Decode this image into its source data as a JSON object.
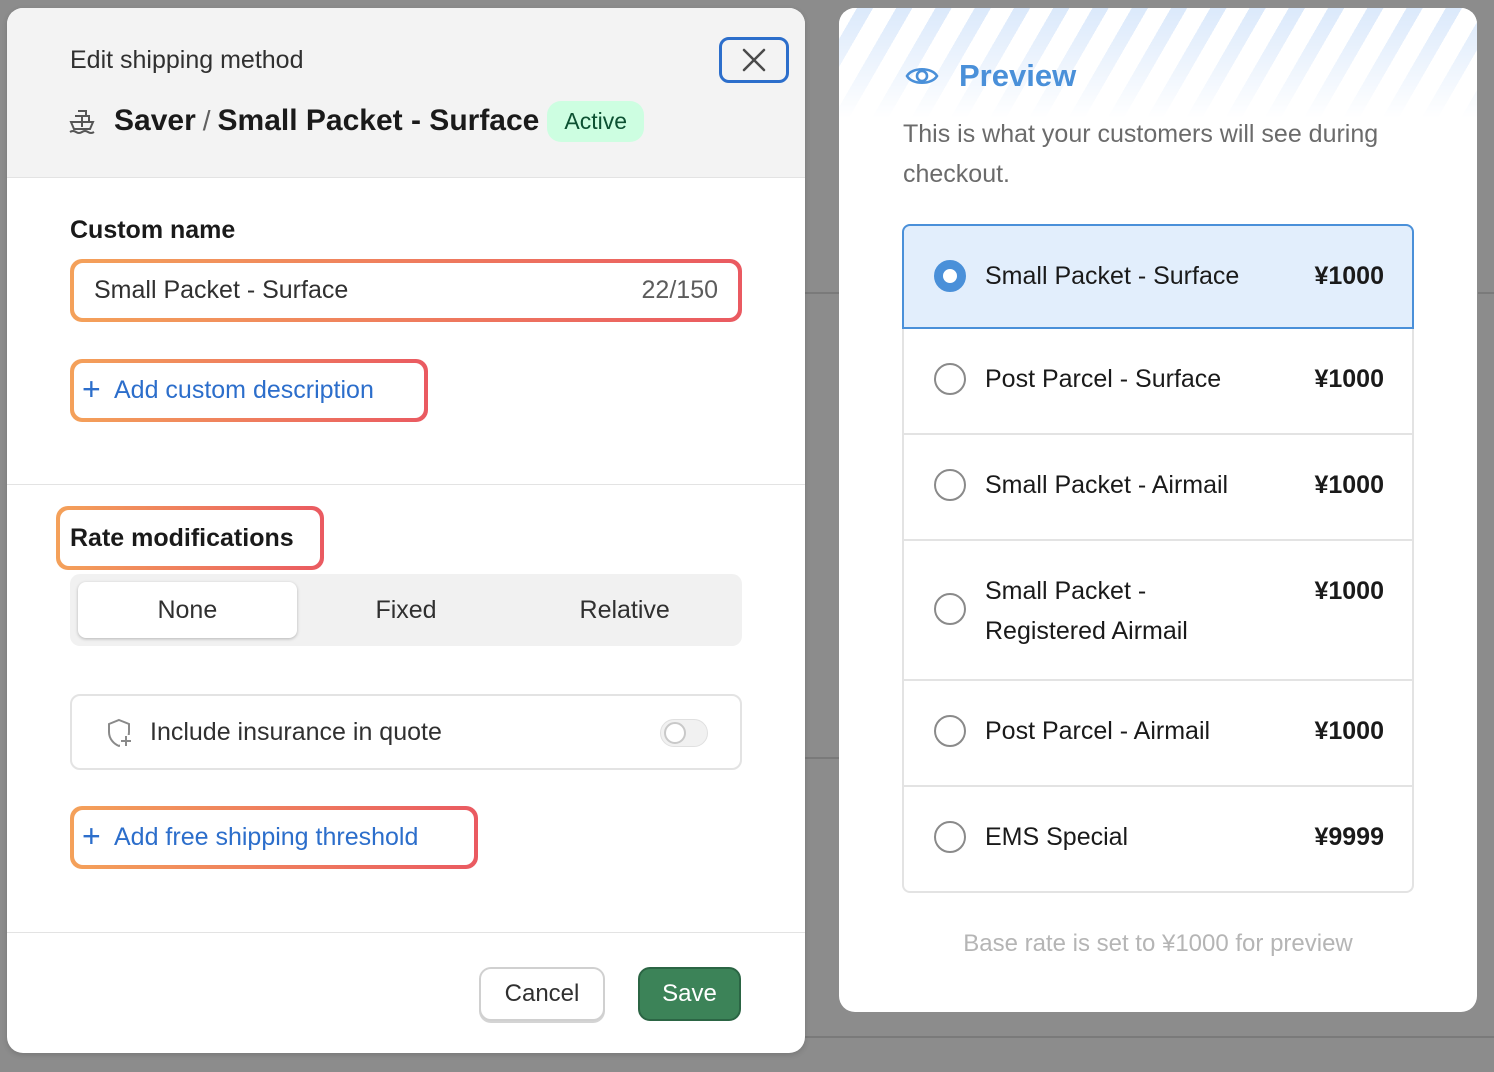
{
  "modal": {
    "caption": "Edit shipping method",
    "title_carrier": "Saver",
    "title_separator": "/",
    "title_method": "Small Packet - Surface",
    "status_badge": "Active",
    "custom_name": {
      "label": "Custom name",
      "value": "Small Packet - Surface",
      "char_count": "22/150"
    },
    "add_description_label": "Add custom description",
    "rate_modifications": {
      "label": "Rate modifications",
      "options": [
        "None",
        "Fixed",
        "Relative"
      ],
      "selected": "None"
    },
    "insurance": {
      "label": "Include insurance in quote",
      "enabled": false
    },
    "add_threshold_label": "Add free shipping threshold",
    "cancel_label": "Cancel",
    "save_label": "Save"
  },
  "preview": {
    "title": "Preview",
    "subtitle": "This is what your customers will see during checkout.",
    "options": [
      {
        "name": "Small Packet - Surface",
        "price": "¥1000",
        "selected": true
      },
      {
        "name": "Post Parcel - Surface",
        "price": "¥1000",
        "selected": false
      },
      {
        "name": "Small Packet - Airmail",
        "price": "¥1000",
        "selected": false
      },
      {
        "name": "Small Packet - Registered Airmail",
        "price": "¥1000",
        "selected": false
      },
      {
        "name": "Post Parcel - Airmail",
        "price": "¥1000",
        "selected": false
      },
      {
        "name": "EMS Special",
        "price": "¥9999",
        "selected": false
      }
    ],
    "footnote": "Base rate is set to ¥1000 for preview"
  },
  "colors": {
    "accent": "#2c6ecb",
    "preview_accent": "#4a90d9",
    "save_green": "#3c8358",
    "badge_bg": "#cdfee1",
    "highlight_start": "#f4a15a",
    "highlight_end": "#ea5a61"
  }
}
